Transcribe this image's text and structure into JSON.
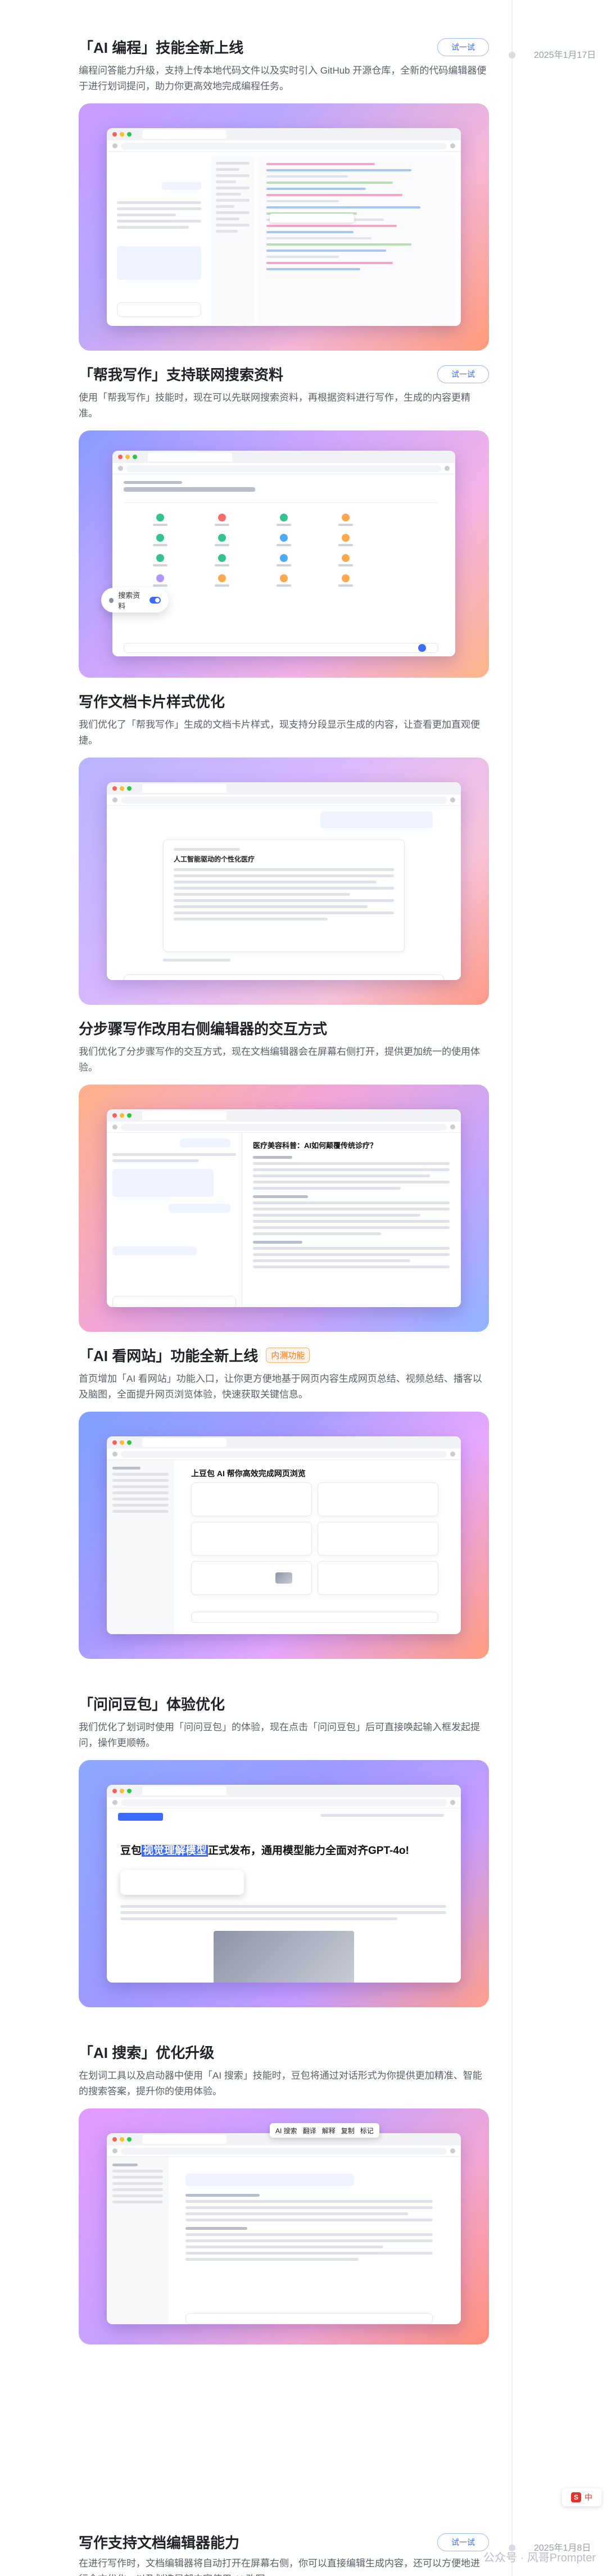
{
  "timeline": {
    "date_top": "2025年1月17日",
    "date_bottom": "2025年1月8日"
  },
  "sections": [
    {
      "title": "「AI 编程」技能全新上线",
      "desc": "编程问答能力升级，支持上传本地代码文件以及实时引入 GitHub 开源仓库，全新的代码编辑器便于进行划词提问，助力你更高效地完成编程任务。",
      "button": "试一试"
    },
    {
      "title": "「帮我写作」支持联网搜索资料",
      "desc": "使用「帮我写作」技能时，现在可以先联网搜索资料，再根据资料进行写作，生成的内容更精准。",
      "button": "试一试"
    },
    {
      "title": "写作文档卡片样式优化",
      "desc": "我们优化了「帮我写作」生成的文档卡片样式，现支持分段显示生成的内容，让查看更加直观便捷。"
    },
    {
      "title": "分步骤写作改用右侧编辑器的交互方式",
      "desc": "我们优化了分步骤写作的交互方式，现在文档编辑器会在屏幕右侧打开，提供更加统一的使用体验。"
    },
    {
      "title": "「AI 看网站」功能全新上线",
      "badge": "内测功能",
      "desc": "首页增加「AI 看网站」功能入口，让你更方便地基于网页内容生成网页总结、视频总结、播客以及脑图，全面提升网页浏览体验，快速获取关键信息。"
    },
    {
      "title": "「问问豆包」体验优化",
      "desc": "我们优化了划词时使用「问问豆包」的体验，现在点击「问问豆包」后可直接唤起输入框发起提问，操作更顺畅。"
    },
    {
      "title": "「AI 搜索」优化升级",
      "desc": "在划词工具以及启动器中使用「AI 搜索」技能时，豆包将通过对话形式为你提供更加精准、智能的搜索答案，提升你的使用体验。"
    },
    {
      "title": "写作支持文档编辑器能力",
      "desc": "在进行写作时，文档编辑器将自动打开在屏幕右侧，你可以直接编辑生成内容，还可以方便地进行全文优化，以及划选局部内容使用 AI 改写。",
      "button": "试一试"
    }
  ],
  "screenshots": {
    "s2_callout": "搜索资料",
    "s3_doc_title": "人工智能驱动的个性化医疗",
    "s4_doc_title": "医疗美容科普：AI如何颠覆传统诊疗？",
    "s5_page_title": "上豆包 AI 帮你高效完成网页浏览",
    "s6_headline_before": "豆包",
    "s6_headline_highlight": "视觉理解模型",
    "s6_headline_after": "正式发布，通用模型能力全面对齐GPT-4o!",
    "s7_toolbar": [
      "AI 搜索",
      "翻译",
      "解释",
      "复制",
      "标记"
    ]
  },
  "watermark": "公众号 · 风哥Prompter",
  "float_tool": {
    "logo": "S",
    "label": "中"
  },
  "colors": {
    "accent": "#3b6cff",
    "badge": "#ff7a1a"
  }
}
